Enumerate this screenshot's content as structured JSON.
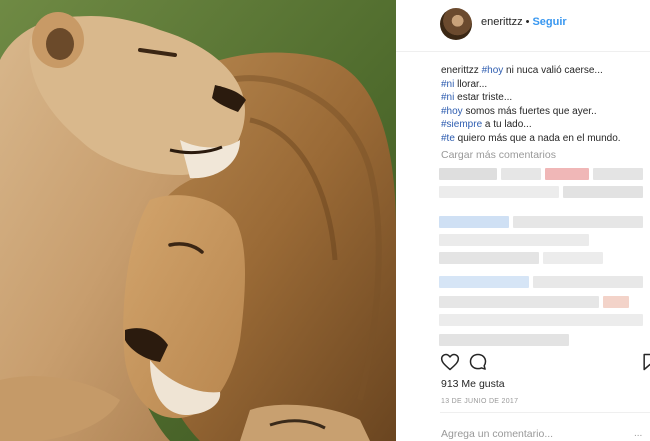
{
  "post": {
    "author": "enerittzz",
    "separator": "•",
    "follow_label": "Seguir",
    "photo_alt": "lion-couple-photo"
  },
  "caption": {
    "lines": [
      {
        "pre": "enerittzz ",
        "tag": "#hoy",
        "post": " ni nuca valió caerse..."
      },
      {
        "pre": "",
        "tag": "#ni",
        "post": " llorar..."
      },
      {
        "pre": "",
        "tag": "#ni",
        "post": " estar triste..."
      },
      {
        "pre": "",
        "tag": "#hoy",
        "post": " somos más fuertes que ayer.."
      },
      {
        "pre": "",
        "tag": "#siempre",
        "post": " a tu lado..."
      },
      {
        "pre": "",
        "tag": "#te",
        "post": " quiero más que a nada en el mundo."
      }
    ]
  },
  "comments": {
    "load_more": "Cargar más comentarios"
  },
  "actions": {
    "like_icon": "heart-icon",
    "comment_icon": "comment-icon",
    "save_icon": "bookmark-icon"
  },
  "stats": {
    "likes": "913 Me gusta",
    "date": "13 DE JUNIO DE 2017"
  },
  "composer": {
    "placeholder": "Agrega un comentario...",
    "more": "..."
  },
  "colors": {
    "accent": "#3897f0",
    "hashtag": "#2e5db0",
    "muted": "#999999",
    "text": "#262626"
  }
}
